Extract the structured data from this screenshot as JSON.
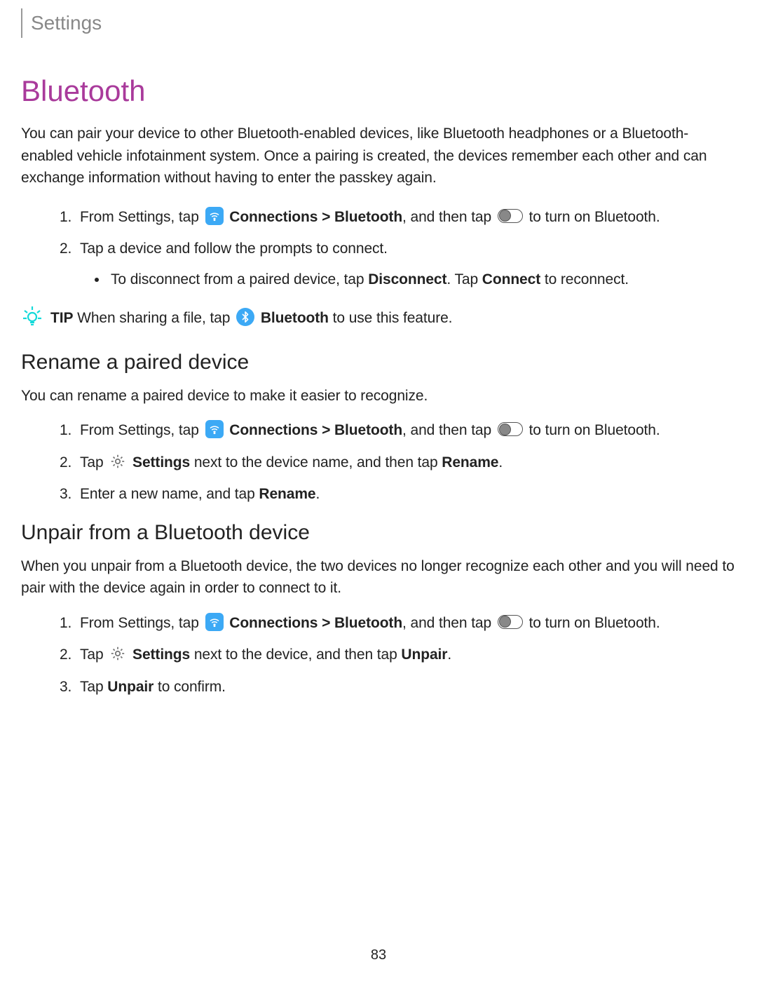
{
  "header": "Settings",
  "title": "Bluetooth",
  "intro": "You can pair your device to other Bluetooth-enabled devices, like Bluetooth headphones or a Bluetooth-enabled vehicle infotainment system. Once a pairing is created, the devices remember each other and can exchange information without having to enter the passkey again.",
  "step1": {
    "pre": "From Settings, tap ",
    "conn": "Connections > Bluetooth",
    "mid": ", and then tap ",
    "end": " to turn on Bluetooth."
  },
  "step2": "Tap a device and follow the prompts to connect.",
  "step2sub": {
    "pre": "To disconnect from a paired device, tap ",
    "a": "Disconnect",
    "mid": ". Tap ",
    "b": "Connect",
    "end": " to reconnect."
  },
  "tip": {
    "label": "TIP",
    "pre": " When sharing a file, tap ",
    "b": "Bluetooth",
    "end": " to use this feature."
  },
  "rename": {
    "heading": "Rename a paired device",
    "intro": "You can rename a paired device to make it easier to recognize.",
    "step2": {
      "pre": "Tap ",
      "s": "Settings",
      "mid": " next to the device name, and then tap ",
      "r": "Rename",
      "end": "."
    },
    "step3": {
      "pre": "Enter a new name, and tap ",
      "r": "Rename",
      "end": "."
    }
  },
  "unpair": {
    "heading": "Unpair from a Bluetooth device",
    "intro": "When you unpair from a Bluetooth device, the two devices no longer recognize each other and you will need to pair with the device again in order to connect to it.",
    "step2": {
      "pre": "Tap ",
      "s": "Settings",
      "mid": " next to the device, and then tap ",
      "u": "Unpair",
      "end": "."
    },
    "step3": {
      "pre": "Tap ",
      "u": "Unpair",
      "end": " to confirm."
    }
  },
  "page_number": "83"
}
